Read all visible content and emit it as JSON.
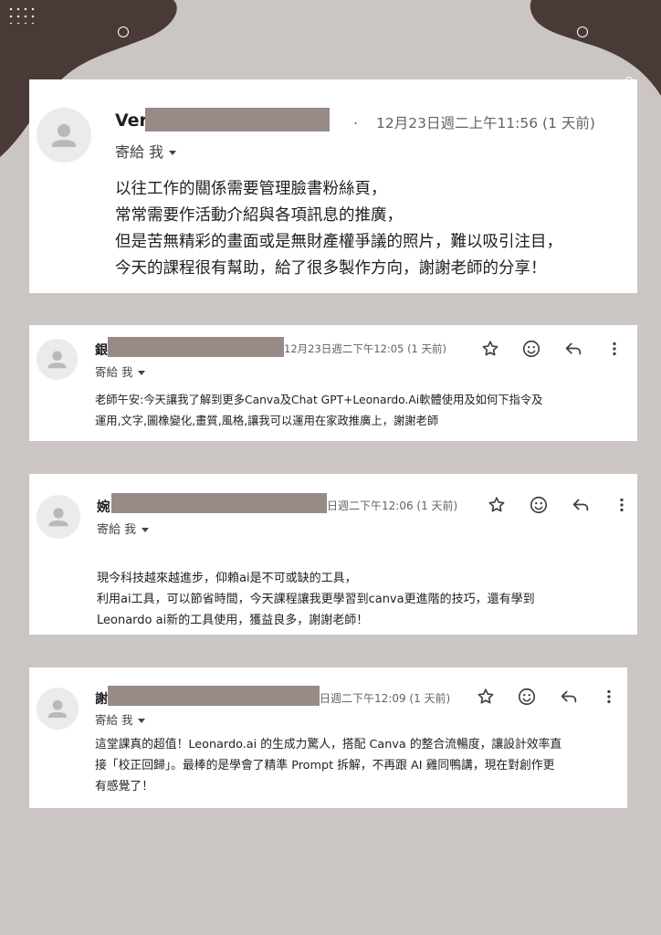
{
  "colors": {
    "background": "#cbc6c3",
    "blob": "#4a3a37",
    "redaction": "#988b87",
    "card": "#ffffff",
    "meta_text": "#5f6368"
  },
  "emails": [
    {
      "sender": "Ver",
      "after_redaction": ".",
      "timestamp": "12月23日週二上午11:56 (1 天前)",
      "recipient": "寄給 我",
      "body": [
        "以往工作的關係需要管理臉書粉絲頁，",
        "常常需要作活動介紹與各項訊息的推廣，",
        "但是苦無精彩的畫面或是無財產權爭議的照片，難以吸引注目，",
        "今天的課程很有幫助，給了很多製作方向，謝謝老師的分享！"
      ]
    },
    {
      "sender": "銀",
      "timestamp": "12月23日週二下午12:05 (1 天前)",
      "recipient": "寄給 我",
      "body": [
        "老師午安:今天讓我了解到更多Canva及Chat GPT+Leonardo.Ai軟體使用及如何下指令及",
        "運用,文字,圖橡變化,畫質,風格,讓我可以運用在家政推廣上，謝謝老師"
      ]
    },
    {
      "sender": "婉",
      "timestamp": "日週二下午12:06 (1 天前)",
      "recipient": "寄給 我",
      "body": [
        "現今科技越來越進步，仰賴ai是不可或缺的工具，",
        "利用ai工具，可以節省時間，今天課程讓我更學習到canva更進階的技巧，還有學到",
        "Leonardo ai新的工具使用，獲益良多，謝謝老師！"
      ]
    },
    {
      "sender": "謝",
      "timestamp": "日週二下午12:09 (1 天前)",
      "recipient": "寄給 我",
      "body": [
        "這堂課真的超值！Leonardo.ai 的生成力驚人，搭配 Canva 的整合流暢度，讓設計效率直",
        "接「校正回歸」。最棒的是學會了精準 Prompt 拆解，不再跟 AI 雞同鴨講，現在對創作更",
        "有感覺了！"
      ]
    }
  ],
  "icons": [
    "avatar-icon",
    "star-icon",
    "smiley-icon",
    "reply-icon",
    "more-vert-icon",
    "chevron-down-icon"
  ]
}
